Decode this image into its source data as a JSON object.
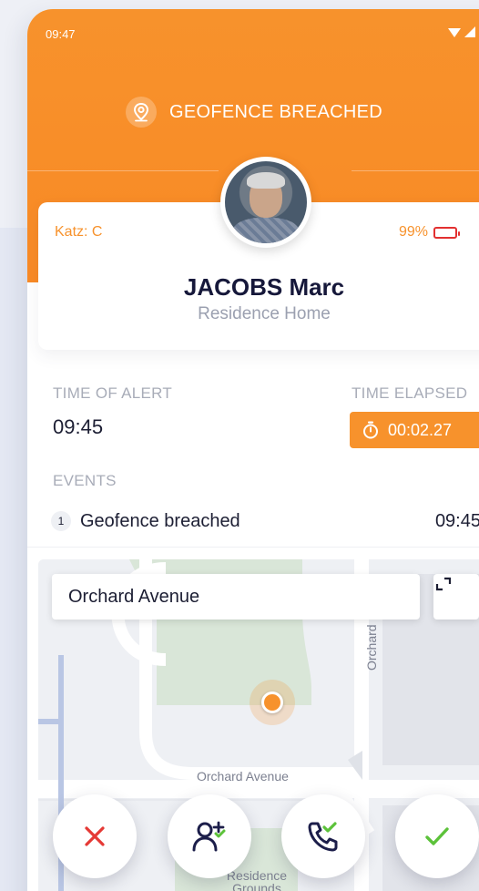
{
  "status_bar": {
    "time": "09:47"
  },
  "alert": {
    "title": "GEOFENCE BREACHED"
  },
  "resident": {
    "category": "Katz: C",
    "battery": "99%",
    "battery_level": 0.99,
    "name": "JACOBS Marc",
    "residence": "Residence Home"
  },
  "details": {
    "time_of_alert_label": "TIME OF ALERT",
    "time_of_alert": "09:45",
    "time_elapsed_label": "TIME ELAPSED",
    "time_elapsed": "00:02.27",
    "events_label": "EVENTS",
    "events": [
      {
        "number": "1",
        "description": "Geofence breached",
        "time": "09:45"
      }
    ]
  },
  "map": {
    "search_value": "Orchard Avenue",
    "street_horizontal": "Orchard Avenue",
    "street_vertical": "Orchard",
    "park_label": "Residence Grounds"
  },
  "actions": [
    {
      "name": "dismiss",
      "icon": "close-icon",
      "color": "#e53935"
    },
    {
      "name": "assign",
      "icon": "add-user-icon",
      "color": "#1c1e4a"
    },
    {
      "name": "call",
      "icon": "phone-check-icon",
      "color": "#1c1e4a"
    },
    {
      "name": "accept",
      "icon": "check-icon",
      "color": "#5cc23a"
    }
  ],
  "colors": {
    "accent": "#f7922c",
    "navy": "#16183a",
    "danger": "#e23030",
    "success": "#5cc23a"
  }
}
